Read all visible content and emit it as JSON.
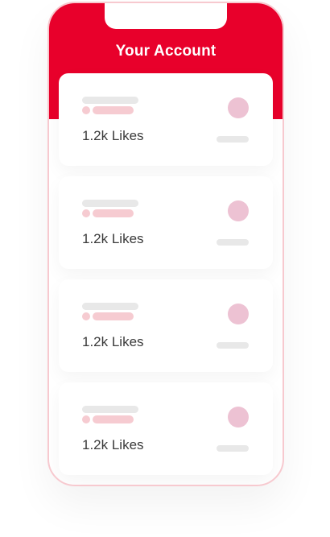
{
  "app": {
    "title": "Your Account"
  },
  "colors": {
    "brand_red": "#e8002b",
    "placeholder_pink": "#f6cbd1",
    "placeholder_grey": "#e8e8e8",
    "avatar_pink": "#edc2d3"
  },
  "cards": [
    {
      "likes_label": "1.2k Likes"
    },
    {
      "likes_label": "1.2k Likes"
    },
    {
      "likes_label": "1.2k Likes"
    },
    {
      "likes_label": "1.2k Likes"
    }
  ]
}
